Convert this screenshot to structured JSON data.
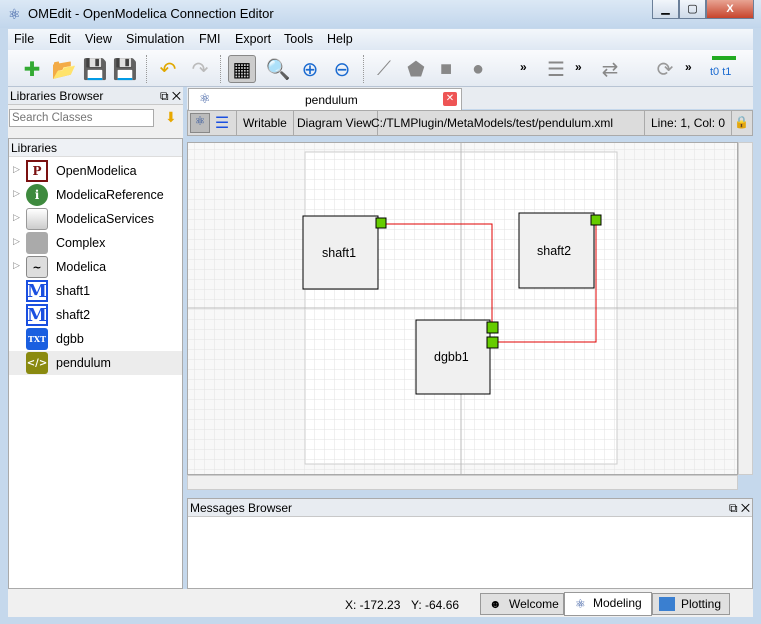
{
  "window": {
    "title": "OMEdit - OpenModelica Connection Editor",
    "minimize": "▁",
    "maximize": "▢",
    "close": "X"
  },
  "menu": [
    "File",
    "Edit",
    "View",
    "Simulation",
    "FMI",
    "Export",
    "Tools",
    "Help"
  ],
  "toolbar": {
    "overflow": "»",
    "time_labels": "t0 t1"
  },
  "libraries_browser": {
    "title": "Libraries Browser",
    "search_placeholder": "Search Classes",
    "tree_header": "Libraries",
    "items": [
      {
        "label": "OpenModelica",
        "icon": "P",
        "expandable": true
      },
      {
        "label": "ModelicaReference",
        "icon": "i",
        "expandable": true
      },
      {
        "label": "ModelicaServices",
        "icon": "",
        "expandable": true
      },
      {
        "label": "Complex",
        "icon": "",
        "expandable": true
      },
      {
        "label": "Modelica",
        "icon": "~",
        "expandable": true
      },
      {
        "label": "shaft1",
        "icon": "M"
      },
      {
        "label": "shaft2",
        "icon": "M"
      },
      {
        "label": "dgbb",
        "icon": "TXT"
      },
      {
        "label": "pendulum",
        "icon": "</>",
        "selected": true
      }
    ]
  },
  "editor": {
    "tab": "pendulum",
    "mode": "Writable",
    "view": "Diagram View",
    "path": "C:/TLMPlugin/MetaModels/test/pendulum.xml",
    "cursor": "Line: 1, Col: 0",
    "components": [
      {
        "name": "shaft1"
      },
      {
        "name": "shaft2"
      },
      {
        "name": "dgbb1"
      }
    ],
    "connection_color": "#e00000",
    "port_color": "#66cc00"
  },
  "messages": {
    "title": "Messages Browser"
  },
  "status": {
    "x": "X: -172.23",
    "y": "Y: -64.66",
    "perspectives": [
      "Welcome",
      "Modeling",
      "Plotting"
    ],
    "active": "Modeling"
  }
}
